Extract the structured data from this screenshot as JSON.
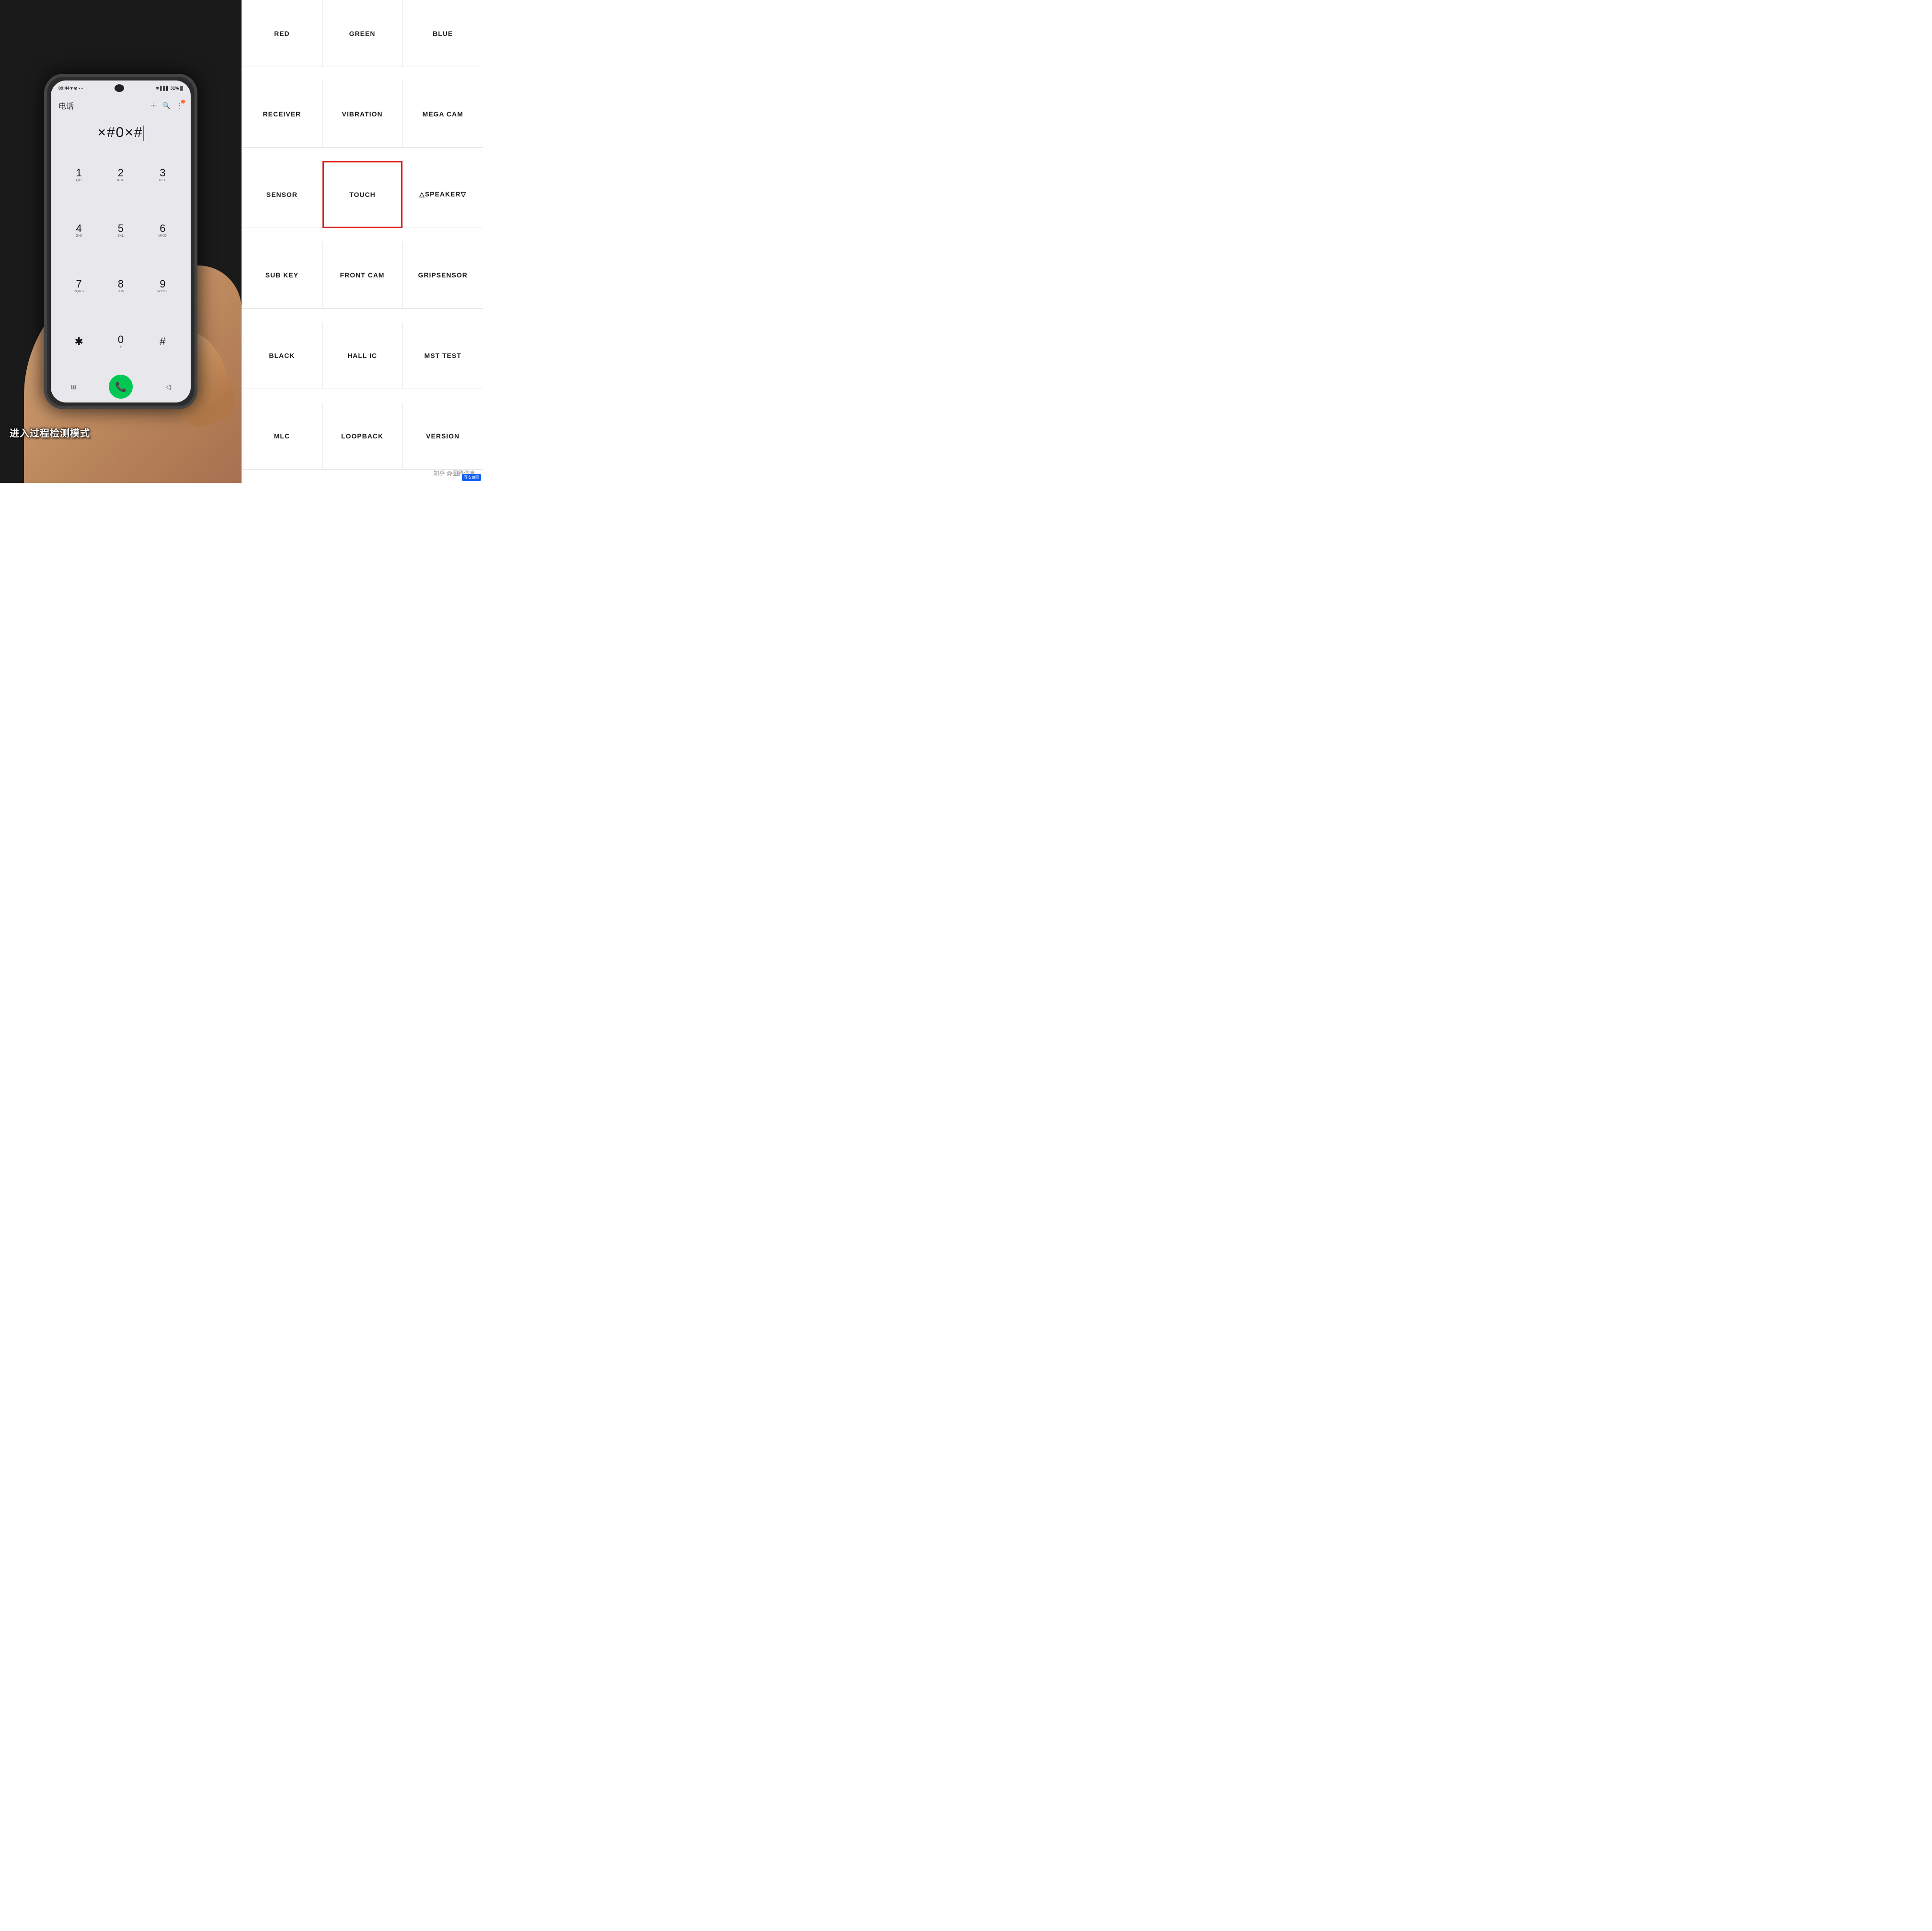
{
  "left": {
    "statusBar": {
      "time": "09:44",
      "signal": "31%",
      "icons": "▾ ⊗ ▪ •"
    },
    "appTitle": "电话",
    "dialDisplay": "×#0×#",
    "keys": [
      {
        "num": "1",
        "letters": "QO"
      },
      {
        "num": "2",
        "letters": "ABC"
      },
      {
        "num": "3",
        "letters": "DEF"
      },
      {
        "num": "4",
        "letters": "GHI"
      },
      {
        "num": "5",
        "letters": "JKL"
      },
      {
        "num": "6",
        "letters": "MNO"
      },
      {
        "num": "7",
        "letters": "PQRS"
      },
      {
        "num": "8",
        "letters": "TUV"
      },
      {
        "num": "9",
        "letters": "WXYZ"
      },
      {
        "num": "✱",
        "letters": ""
      },
      {
        "num": "0",
        "letters": "+"
      },
      {
        "num": "#",
        "letters": ""
      }
    ],
    "subtitle": "进入过程检测模式"
  },
  "right": {
    "cells": [
      {
        "label": "RED",
        "highlighted": false
      },
      {
        "label": "GREEN",
        "highlighted": false
      },
      {
        "label": "BLUE",
        "highlighted": false
      },
      {
        "label": "RECEIVER",
        "highlighted": false
      },
      {
        "label": "VIBRATION",
        "highlighted": false
      },
      {
        "label": "MEGA CAM",
        "highlighted": false
      },
      {
        "label": "SENSOR",
        "highlighted": false
      },
      {
        "label": "TOUCH",
        "highlighted": true
      },
      {
        "label": "△SPEAKER▽",
        "highlighted": false
      },
      {
        "label": "SUB KEY",
        "highlighted": false
      },
      {
        "label": "FRONT CAM",
        "highlighted": false
      },
      {
        "label": "GRIPSENSOR",
        "highlighted": false
      },
      {
        "label": "BLACK",
        "highlighted": false
      },
      {
        "label": "HALL IC",
        "highlighted": false
      },
      {
        "label": "MST TEST",
        "highlighted": false
      },
      {
        "label": "MLC",
        "highlighted": false
      },
      {
        "label": "LOOPBACK",
        "highlighted": false
      },
      {
        "label": "VERSION",
        "highlighted": false
      }
    ],
    "watermark": "知乎 @图腾信息"
  }
}
